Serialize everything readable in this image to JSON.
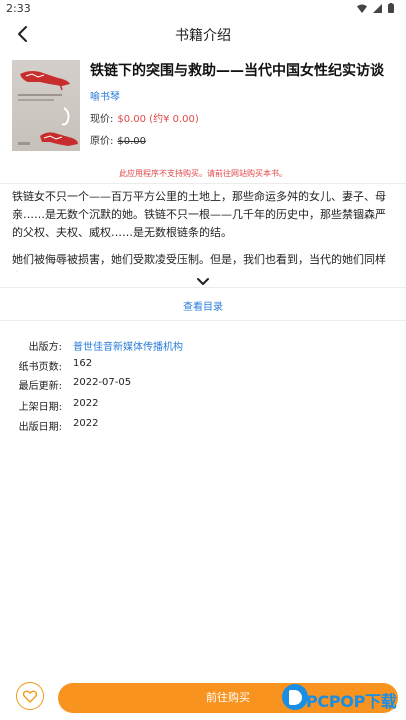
{
  "status_bar": {
    "time": "2:33"
  },
  "nav": {
    "title": "书籍介绍"
  },
  "book": {
    "title": "铁链下的突围与救助——当代中国女性纪实访谈",
    "author": "喻书琴",
    "price_now_label": "现价:",
    "price_now_value": "$0.00 (约¥ 0.00)",
    "price_orig_label": "原价:",
    "price_orig_value": "$0.00",
    "notice": "此应用程序不支持购买。请前往网站购买本书。"
  },
  "description": {
    "para1": "铁链女不只一个——百万平方公里的土地上，那些命运多舛的女儿、妻子、母亲……是无数个沉默的她。铁链不只一根——几千年的历史中，那些禁锢森严的父权、夫权、威权……是无数根链条的结。",
    "para2": "她们被侮辱被损害，她们受欺凌受压制。但是，我们也看到，当代的她们同样在"
  },
  "toc": {
    "label": "查看目录"
  },
  "meta": [
    {
      "label": "出版方:",
      "value": "普世佳音新媒体传播机构",
      "is_link": true
    },
    {
      "label": "纸书页数:",
      "value": "162",
      "is_link": false
    },
    {
      "label": "最后更新:",
      "value": "2022-07-05",
      "is_link": false
    },
    {
      "label": "上架日期:",
      "value": "2022",
      "is_link": false
    },
    {
      "label": "出版日期:",
      "value": "2022",
      "is_link": false
    }
  ],
  "bottom": {
    "buy_label": "前往购买"
  },
  "watermark": {
    "text": "PCPOP下载"
  },
  "colors": {
    "accent_orange": "#f7931e",
    "link_blue": "#2a7ed8",
    "price_red": "#e04848"
  }
}
